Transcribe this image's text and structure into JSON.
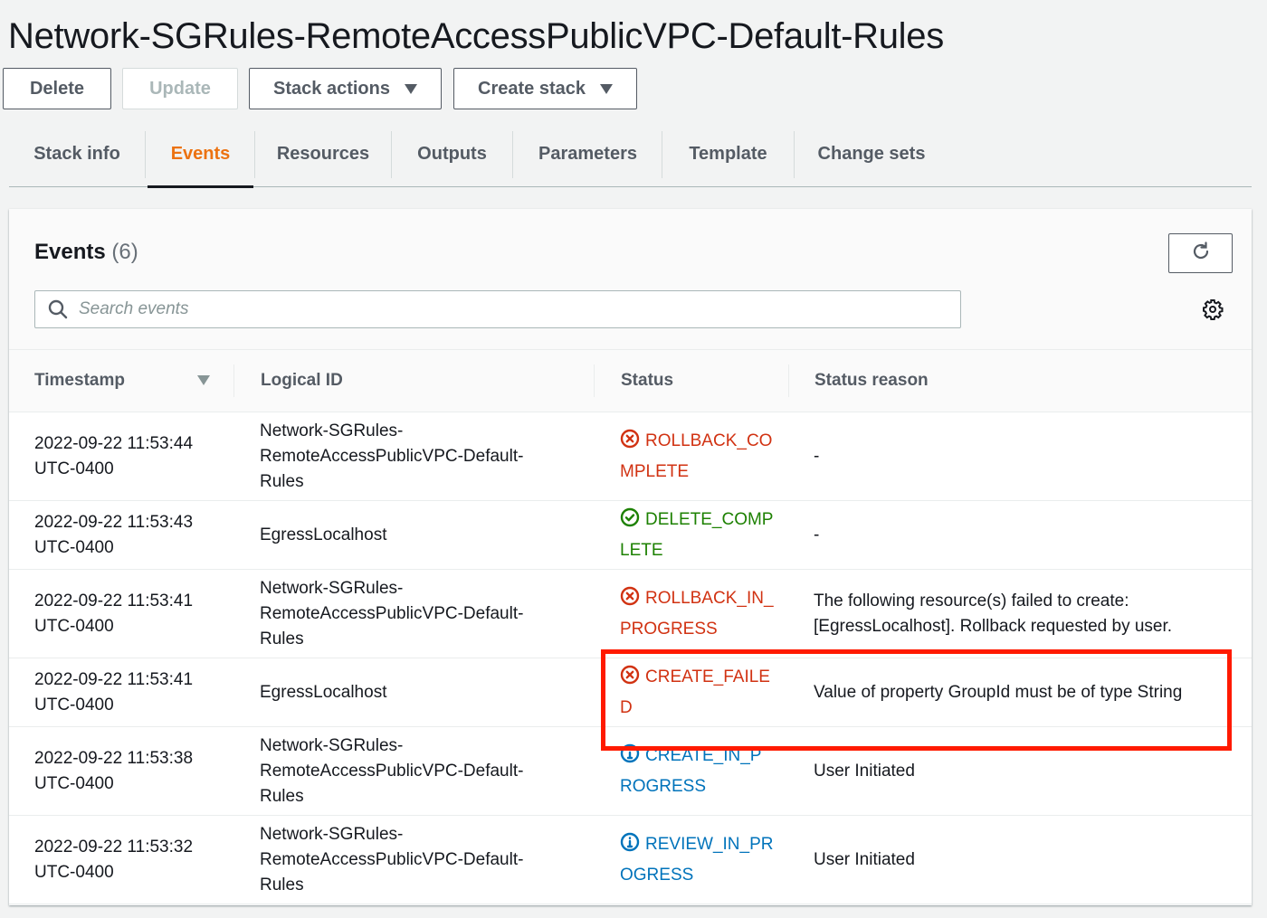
{
  "page": {
    "title": "Network-SGRules-RemoteAccessPublicVPC-Default-Rules"
  },
  "toolbar": {
    "delete_label": "Delete",
    "update_label": "Update",
    "stack_actions_label": "Stack actions",
    "create_stack_label": "Create stack"
  },
  "tabs": [
    {
      "label": "Stack info",
      "active": false
    },
    {
      "label": "Events",
      "active": true
    },
    {
      "label": "Resources",
      "active": false
    },
    {
      "label": "Outputs",
      "active": false
    },
    {
      "label": "Parameters",
      "active": false
    },
    {
      "label": "Template",
      "active": false
    },
    {
      "label": "Change sets",
      "active": false
    }
  ],
  "events": {
    "heading": "Events",
    "count": "(6)",
    "search_placeholder": "Search events",
    "icons": {
      "refresh": "refresh-icon",
      "settings": "gear-icon",
      "search": "search-icon"
    },
    "columns": [
      "Timestamp",
      "Logical ID",
      "Status",
      "Status reason"
    ],
    "rows": [
      {
        "timestamp": [
          "2022-09-22 11:53:44",
          "UTC-0400"
        ],
        "logical_id": [
          "Network-SGRules-",
          "RemoteAccessPublicVPC-Default-",
          "Rules"
        ],
        "status": "ROLLBACK_COMPLETE",
        "status_type": "error",
        "reason": "-"
      },
      {
        "timestamp": [
          "2022-09-22 11:53:43",
          "UTC-0400"
        ],
        "logical_id": [
          "EgressLocalhost"
        ],
        "status": "DELETE_COMPLETE",
        "status_type": "success",
        "reason": "-"
      },
      {
        "timestamp": [
          "2022-09-22 11:53:41",
          "UTC-0400"
        ],
        "logical_id": [
          "Network-SGRules-",
          "RemoteAccessPublicVPC-Default-",
          "Rules"
        ],
        "status": "ROLLBACK_IN_PROGRESS",
        "status_type": "error",
        "reason": "The following resource(s) failed to create: [EgressLocalhost]. Rollback requested by user."
      },
      {
        "timestamp": [
          "2022-09-22 11:53:41",
          "UTC-0400"
        ],
        "logical_id": [
          "EgressLocalhost"
        ],
        "status": "CREATE_FAILED",
        "status_type": "error",
        "reason": "Value of property GroupId must be of type String"
      },
      {
        "timestamp": [
          "2022-09-22 11:53:38",
          "UTC-0400"
        ],
        "logical_id": [
          "Network-SGRules-",
          "RemoteAccessPublicVPC-Default-",
          "Rules"
        ],
        "status": "CREATE_IN_PROGRESS",
        "status_type": "info",
        "reason": "User Initiated"
      },
      {
        "timestamp": [
          "2022-09-22 11:53:32",
          "UTC-0400"
        ],
        "logical_id": [
          "Network-SGRules-",
          "RemoteAccessPublicVPC-Default-",
          "Rules"
        ],
        "status": "REVIEW_IN_PROGRESS",
        "status_type": "info",
        "reason": "User Initiated"
      }
    ]
  },
  "colors": {
    "accent_active_tab": "#ec7211",
    "status_error": "#d13212",
    "status_success": "#1d8102",
    "status_info": "#0073bb",
    "highlight_annotation": "#ff1a00"
  },
  "annotation": {
    "highlighted_row_index": 3
  }
}
